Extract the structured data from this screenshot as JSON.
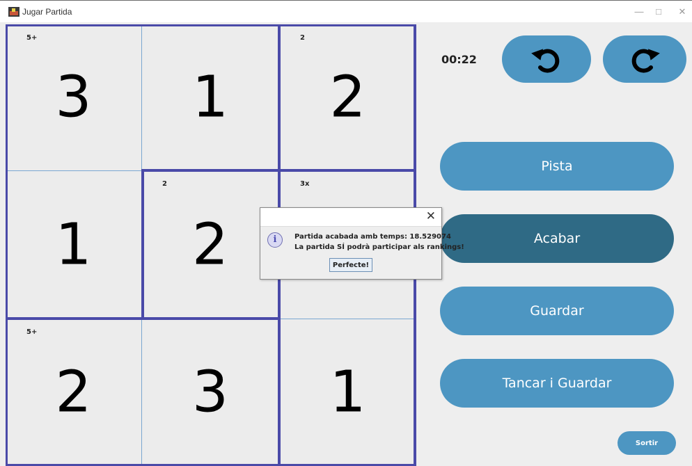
{
  "window": {
    "title": "Jugar Partida",
    "minimize_glyph": "—",
    "maximize_glyph": "□",
    "close_glyph": "✕"
  },
  "board": {
    "cells": [
      {
        "value": "3",
        "cage_label": "5+"
      },
      {
        "value": "1",
        "cage_label": ""
      },
      {
        "value": "2",
        "cage_label": "2"
      },
      {
        "value": "1",
        "cage_label": ""
      },
      {
        "value": "2",
        "cage_label": "2"
      },
      {
        "value": "",
        "cage_label": "3x"
      },
      {
        "value": "2",
        "cage_label": "5+"
      },
      {
        "value": "3",
        "cage_label": ""
      },
      {
        "value": "1",
        "cage_label": ""
      }
    ]
  },
  "side": {
    "timer": "00:22",
    "undo_icon": "undo-icon",
    "redo_icon": "redo-icon",
    "pista_label": "Pista",
    "acabar_label": "Acabar",
    "guardar_label": "Guardar",
    "tancar_label": "Tancar i Guardar",
    "sortir_label": "Sortir"
  },
  "dialog": {
    "close_glyph": "✕",
    "info_glyph": "i",
    "message_line1": "Partida acabada amb temps: 18.529074",
    "message_line2": "La partida SÍ podrà participar als rankings!",
    "ok_label": "Perfecte!"
  },
  "colors": {
    "button": "#4d96c2",
    "button_active": "#2f6a85",
    "cage_border": "#4a4aa8",
    "cell_border": "#7aa7d1"
  }
}
